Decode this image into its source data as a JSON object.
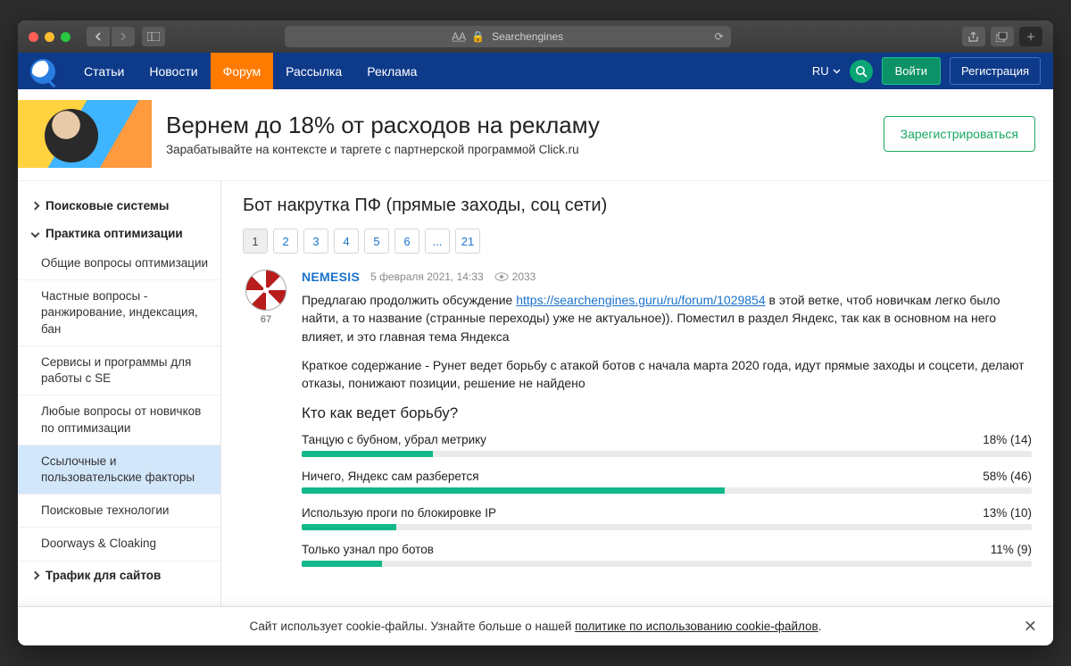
{
  "browser": {
    "title": "Searchengines"
  },
  "nav": {
    "items": [
      "Статьи",
      "Новости",
      "Форум",
      "Рассылка",
      "Реклама"
    ],
    "active_index": 2,
    "lang": "RU",
    "login": "Войти",
    "register": "Регистрация"
  },
  "banner": {
    "headline": "Вернем до 18% от расходов на рекламу",
    "sub": "Зарабатывайте на контексте и таргете с партнерской программой Click.ru",
    "cta": "Зарегистрироваться"
  },
  "sidebar": {
    "groups": [
      {
        "label": "Поисковые системы",
        "expanded": false
      },
      {
        "label": "Практика оптимизации",
        "expanded": true,
        "items": [
          "Общие вопросы оптимизации",
          "Частные вопросы - ранжирование, индексация, бан",
          "Сервисы и программы для работы с SE",
          "Любые вопросы от новичков по оптимизации",
          "Ссылочные и пользовательские факторы",
          "Поисковые технологии",
          "Doorways & Cloaking"
        ],
        "active_index": 4
      },
      {
        "label": "Трафик для сайтов",
        "expanded": false
      }
    ]
  },
  "thread": {
    "title": "Бот накрутка ПФ (прямые заходы, соц сети)",
    "pages": [
      "1",
      "2",
      "3",
      "4",
      "5",
      "6",
      "...",
      "21"
    ],
    "current_page": 0
  },
  "post": {
    "author": "NEMESIS",
    "reputation": "67",
    "datetime": "5 февраля 2021, 14:33",
    "views": "2033",
    "body1a": "Предлагаю продолжить обсуждение ",
    "link": "https://searchengines.guru/ru/forum/1029854",
    "body1b": " в этой ветке, чтоб новичкам легко было найти, а то название (странные переходы) уже не актуальное)). Поместил в раздел Яндекс, так как в основном на него влияет, и это главная тема Яндекса",
    "body2": "Краткое содержание - Рунет ведет борьбу с атакой ботов с начала марта 2020 года, идут прямые заходы и соцсети, делают отказы, понижают позиции, решение не найдено"
  },
  "poll": {
    "question": "Кто как ведет борьбу?",
    "options": [
      {
        "label": "Танцую с бубном, убрал метрику",
        "pct": 18,
        "count": 14
      },
      {
        "label": "Ничего, Яндекс сам разберется",
        "pct": 58,
        "count": 46
      },
      {
        "label": "Использую проги по блокировке IP",
        "pct": 13,
        "count": 10
      },
      {
        "label": "Только узнал про ботов",
        "pct": 11,
        "count": 9
      }
    ]
  },
  "cookie": {
    "text_a": "Сайт использует cookie-файлы. Узнайте больше о нашей ",
    "link": "политике по использованию cookie-файлов",
    "text_b": "."
  },
  "chart_data": {
    "type": "bar",
    "title": "Кто как ведет борьбу?",
    "categories": [
      "Танцую с бубном, убрал метрику",
      "Ничего, Яндекс сам разберется",
      "Использую проги по блокировке IP",
      "Только узнал про ботов"
    ],
    "values": [
      18,
      58,
      13,
      11
    ],
    "counts": [
      14,
      46,
      10,
      9
    ],
    "xlabel": "",
    "ylabel": "%",
    "ylim": [
      0,
      100
    ]
  }
}
